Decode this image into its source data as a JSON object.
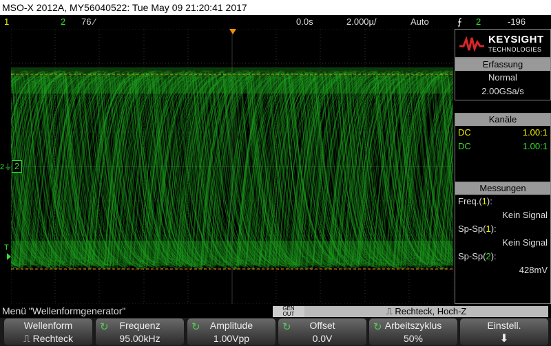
{
  "title": "MSO-X 2012A, MY56040522: Tue May 09 21:20:41 2017",
  "status": {
    "ch1_label": "1",
    "ch2_label": "2",
    "ch2_scale": "76",
    "ch2_scale_unit": " ∕",
    "time_ref": "0.0s",
    "time_scale": "2.000µ/",
    "trigger_mode": "Auto",
    "trigger_icon": "trigger-edge-icon",
    "trigger_source": "2",
    "trigger_level": "-196"
  },
  "brand": {
    "name": "KEYSIGHT",
    "sub": "TECHNOLOGIES",
    "color": "#d9262c"
  },
  "acquisition": {
    "header": "Erfassung",
    "mode": "Normal",
    "rate": "2.00GSa/s"
  },
  "channels": {
    "header": "Kanäle",
    "rows": [
      {
        "coupling": "DC",
        "probe": "1.00:1",
        "color": "#f0f000"
      },
      {
        "coupling": "DC",
        "probe": "1.00:1",
        "color": "#33e033"
      }
    ]
  },
  "measurements": {
    "header": "Messungen",
    "items": [
      {
        "label_pre": "Freq.(",
        "ch": "1",
        "label_post": "):",
        "value": "Kein Signal",
        "ch_color": "#f0f000"
      },
      {
        "label_pre": "Sp-Sp(",
        "ch": "1",
        "label_post": "):",
        "value": "Kein Signal",
        "ch_color": "#f0f000"
      },
      {
        "label_pre": "Sp-Sp(",
        "ch": "2",
        "label_post": "):",
        "value": "428mV",
        "ch_color": "#33e033"
      }
    ]
  },
  "screen": {
    "ch2_marker": "2",
    "trigger_marker": "T",
    "trace_color": "#1fa81f"
  },
  "menu": {
    "title": "Menü \"Wellenformgenerator\"",
    "gen_out_label": "GEN\nOUT",
    "waveform_info": "Rechteck, Hoch-Z"
  },
  "softkeys": [
    {
      "label": "Wellenform",
      "value": "Rechteck",
      "icon": "square-wave-icon"
    },
    {
      "label": "Frequenz",
      "value": "95.00kHz",
      "icon": "rotary-knob-icon"
    },
    {
      "label": "Amplitude",
      "value": "1.00Vpp",
      "icon": "rotary-knob-icon"
    },
    {
      "label": "Offset",
      "value": "0.0V",
      "icon": "rotary-knob-icon"
    },
    {
      "label": "Arbeitszyklus",
      "value": "50%",
      "icon": "rotary-knob-icon"
    },
    {
      "label": "Einstell.",
      "value": "",
      "icon": "down-arrow-icon"
    }
  ]
}
